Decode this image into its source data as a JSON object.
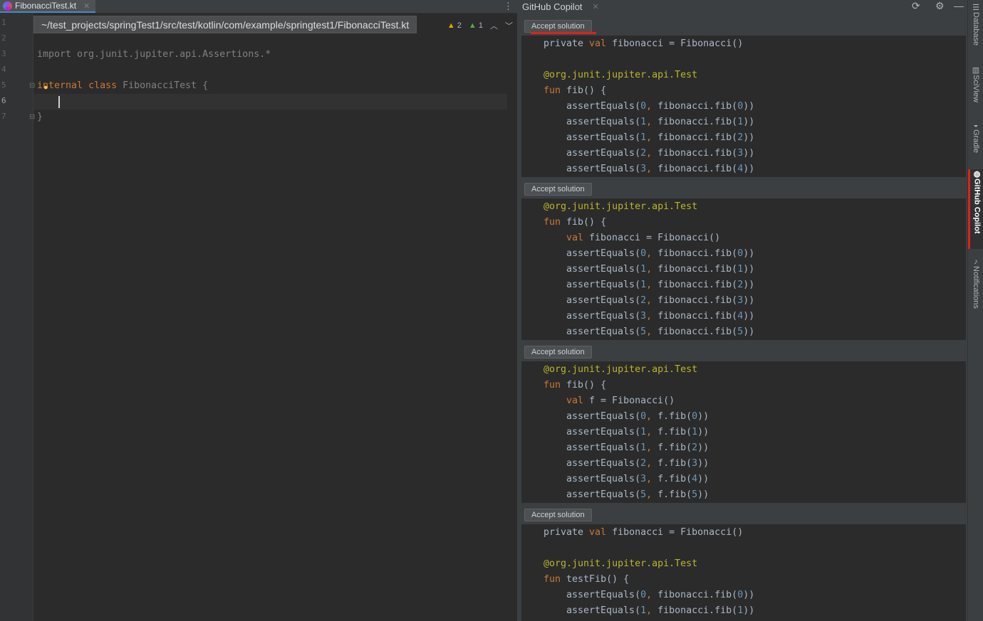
{
  "editor": {
    "tab_label": "FibonacciTest.kt",
    "path": "~/test_projects/springTest1/src/test/kotlin/com/example/springtest1/FibonacciTest.kt",
    "warnings_count": "2",
    "weak_warnings_count": "1",
    "line_numbers": [
      "1",
      "2",
      "3",
      "4",
      "5",
      "6",
      "7"
    ],
    "import_line": "import org.junit.jupiter.api.Assertions.*",
    "class_kw1": "internal",
    "class_kw2": "class",
    "class_name": "FibonacciTest {",
    "close_brace": "}"
  },
  "copilot": {
    "title": "GitHub Copilot",
    "accept_label": "Accept solution"
  },
  "strip": {
    "database": "Database",
    "sciview": "SciView",
    "gradle": "Gradle",
    "copilot": "GitHub Copilot",
    "notifications": "Notifications"
  },
  "colors": {
    "keyword": "#cc7832",
    "number": "#6897bb",
    "annotation": "#bbb529",
    "accent_red": "#e0211b"
  }
}
